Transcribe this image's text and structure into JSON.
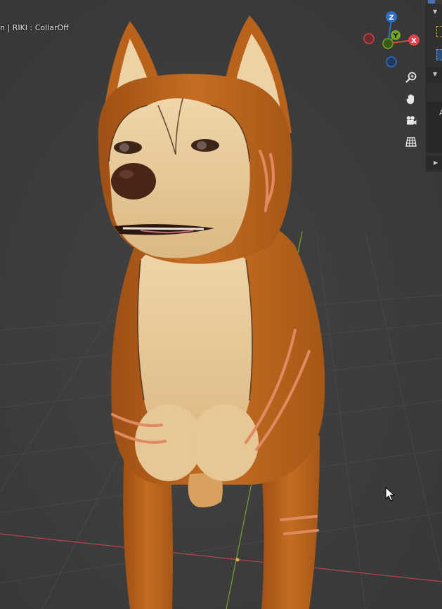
{
  "viewport": {
    "overlay_text": "n | RIKI : CollarOff",
    "gizmo": {
      "z_label": "Z",
      "y_label": "Y",
      "x_label": "X"
    },
    "colors": {
      "x_axis": "#e0424b",
      "y_axis": "#74a625",
      "z_axis": "#2e70c8",
      "fur_orange": "#b8621c",
      "fur_cream": "#e9c99a",
      "background": "#3a3a3a"
    }
  },
  "nav_controls": {
    "zoom": "zoom-icon",
    "pan": "hand-icon",
    "camera": "camera-icon",
    "ortho": "grid-icon"
  },
  "right_panel": {
    "tab_letter": "A"
  }
}
